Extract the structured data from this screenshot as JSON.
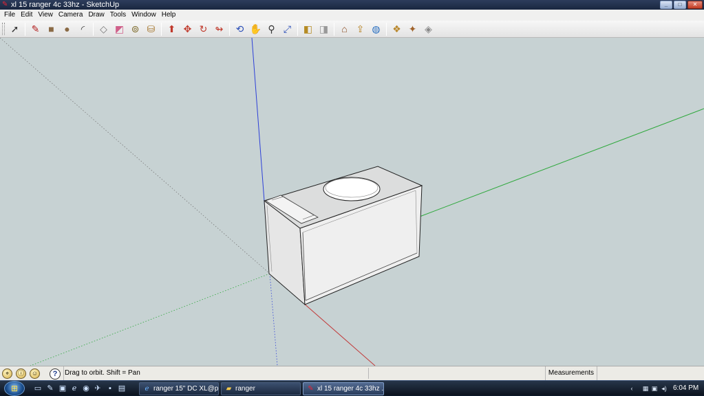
{
  "window": {
    "title": "xl 15 ranger 4c 33hz - SketchUp",
    "controls": {
      "minimize": "_",
      "maximize": "□",
      "close": "✕"
    }
  },
  "menu": [
    "File",
    "Edit",
    "View",
    "Camera",
    "Draw",
    "Tools",
    "Window",
    "Help"
  ],
  "toolbar": {
    "tools": [
      {
        "id": "select",
        "icon": "arrow-pointer-icon",
        "glyph": "➚"
      },
      {
        "id": "pencil",
        "icon": "pencil-icon",
        "glyph": "✎"
      },
      {
        "id": "rectangle",
        "icon": "rectangle-icon",
        "glyph": "■"
      },
      {
        "id": "circle",
        "icon": "circle-icon",
        "glyph": "●"
      },
      {
        "id": "arc",
        "icon": "arc-icon",
        "glyph": "◜"
      },
      {
        "id": "make-component",
        "icon": "component-icon",
        "glyph": "◇"
      },
      {
        "id": "eraser",
        "icon": "eraser-icon",
        "glyph": "◩"
      },
      {
        "id": "tape-measure",
        "icon": "tape-measure-icon",
        "glyph": "⊚"
      },
      {
        "id": "paint-bucket",
        "icon": "paint-bucket-icon",
        "glyph": "⛁"
      },
      {
        "id": "push-pull",
        "icon": "push-pull-icon",
        "glyph": "⬆"
      },
      {
        "id": "move",
        "icon": "move-icon",
        "glyph": "✥"
      },
      {
        "id": "rotate",
        "icon": "rotate-icon",
        "glyph": "↻"
      },
      {
        "id": "follow-me",
        "icon": "follow-me-icon",
        "glyph": "↬"
      },
      {
        "id": "orbit",
        "icon": "orbit-icon",
        "glyph": "⟲"
      },
      {
        "id": "pan",
        "icon": "pan-hand-icon",
        "glyph": "✋"
      },
      {
        "id": "zoom",
        "icon": "zoom-icon",
        "glyph": "⚲"
      },
      {
        "id": "zoom-extents",
        "icon": "zoom-extents-icon",
        "glyph": "⤢"
      },
      {
        "id": "previous",
        "icon": "previous-view-icon",
        "glyph": "◧"
      },
      {
        "id": "next",
        "icon": "next-view-icon",
        "glyph": "◨"
      },
      {
        "id": "get-models",
        "icon": "get-models-icon",
        "glyph": "⌂"
      },
      {
        "id": "share-model",
        "icon": "share-model-icon",
        "glyph": "⇪"
      },
      {
        "id": "google-earth",
        "icon": "google-earth-icon",
        "glyph": "◍"
      },
      {
        "id": "get-components",
        "icon": "get-components-icon",
        "glyph": "❖"
      },
      {
        "id": "share-component",
        "icon": "share-component-icon",
        "glyph": "✦"
      },
      {
        "id": "extension-warehouse",
        "icon": "warehouse-icon",
        "glyph": "◈"
      }
    ]
  },
  "status": {
    "text": "Drag to orbit.  Shift = Pan",
    "measurements_label": "Measurements",
    "icons": [
      "geo-location-icon",
      "credits-icon",
      "user-icon"
    ]
  },
  "colors": {
    "viewport_bg": "#c7d2d3",
    "axis_blue": "#2c3fd8",
    "axis_red": "#c23a3a",
    "axis_green": "#2ea83c",
    "box_face": "#ececec",
    "box_top": "#d9dada"
  },
  "taskbar": {
    "tasks": [
      {
        "label": "ranger 15\" DC XL@p...",
        "icon": "ie-icon"
      },
      {
        "label": "ranger",
        "icon": "folder-icon"
      },
      {
        "label": "xl 15 ranger 4c 33hz ...",
        "icon": "sketchup-icon",
        "active": true
      }
    ],
    "clock": "6:04 PM"
  }
}
